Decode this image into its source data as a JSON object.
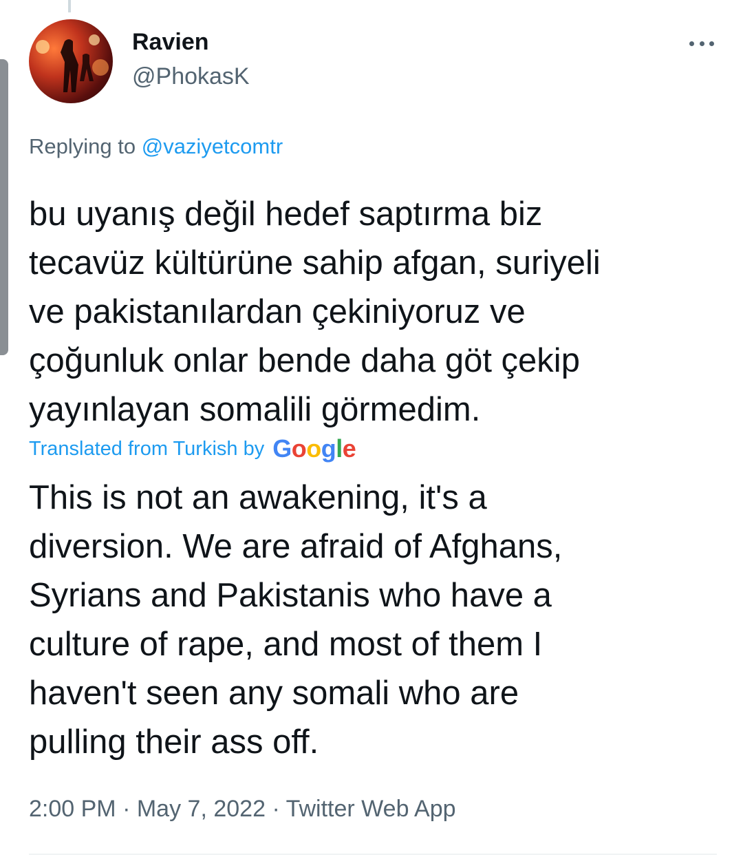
{
  "tweet": {
    "author": {
      "display_name": "Ravien",
      "handle": "@PhokasK"
    },
    "reply_context": {
      "prefix": "Replying to",
      "mention": "@vaziyetcomtr"
    },
    "text": "bu uyanış değil hedef saptırma biz\ntecavüz kültürüne sahip afgan, suriyeli\nve pakistanılardan çekiniyoruz ve\nçoğunluk onlar bende daha göt çekip\nyayınlayan somalili görmedim.",
    "translation_attribution": "Translated from Turkish by",
    "translation_provider": {
      "letters": [
        "G",
        "o",
        "o",
        "g",
        "l",
        "e"
      ],
      "colors": [
        "#4285F4",
        "#EA4335",
        "#FBBC05",
        "#4285F4",
        "#34A853",
        "#EA4335"
      ]
    },
    "translation": "This is not an awakening, it's a\ndiversion. We are afraid of Afghans,\nSyrians and Pakistanis who have a\nculture of rape, and most of them I\nhaven't seen any somali who are\npulling their ass off.",
    "timestamp": {
      "time": "2:00 PM",
      "date": "May 7, 2022",
      "source": "Twitter Web App",
      "separator": "·"
    }
  },
  "icons": {
    "more": "more-horizontal-icon"
  },
  "colors": {
    "link": "#1d9bf0",
    "text_primary": "#0f1419",
    "text_secondary": "#536471"
  }
}
